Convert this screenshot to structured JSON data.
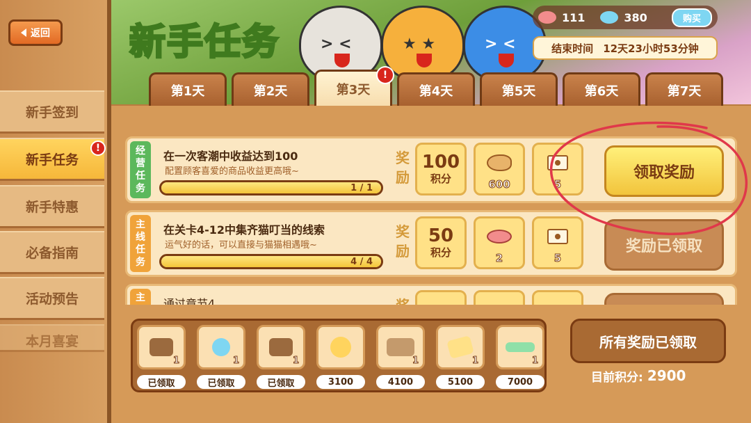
{
  "back": {
    "label": "返回"
  },
  "sidebar": {
    "items": [
      {
        "label": "新手签到"
      },
      {
        "label": "新手任务",
        "badge": "!"
      },
      {
        "label": "新手特惠"
      },
      {
        "label": "必备指南"
      },
      {
        "label": "活动预告"
      },
      {
        "label": "本月喜宴"
      }
    ]
  },
  "header": {
    "title": "新手任务",
    "currency": {
      "fish_pink": "111",
      "fish_blue": "380",
      "buy_label": "购买"
    },
    "end_time": {
      "label": "结束时间",
      "value": "12天23小时53分钟"
    }
  },
  "tabs": [
    {
      "label": "第1天"
    },
    {
      "label": "第2天"
    },
    {
      "label": "第3天",
      "badge": "!"
    },
    {
      "label": "第4天"
    },
    {
      "label": "第5天"
    },
    {
      "label": "第6天"
    },
    {
      "label": "第7天"
    }
  ],
  "tasks": [
    {
      "tag": [
        "经",
        "营",
        "任",
        "务"
      ],
      "title": "在一次客潮中收益达到100",
      "desc": "配置顾客喜爱的商品收益更高哦~",
      "progress_text": "1 / 1",
      "progress": 1.0,
      "reward_label": [
        "奖",
        "励"
      ],
      "points_value": "100",
      "points_unit": "积分",
      "reward2_count": "600",
      "reward3_count": "5",
      "button": "领取奖励"
    },
    {
      "tag": [
        "主",
        "线",
        "任",
        "务"
      ],
      "title": "在关卡4-12中集齐猫叮当的线索",
      "desc": "运气好的话，可以直接与猫猫相遇哦~",
      "progress_text": "4 / 4",
      "progress": 1.0,
      "reward_label": [
        "奖",
        "励"
      ],
      "points_value": "50",
      "points_unit": "积分",
      "reward2_count": "2",
      "reward3_count": "5",
      "button": "奖励已领取"
    },
    {
      "tag": [
        "主"
      ],
      "title": "通过章节4",
      "reward_label": [
        "奖"
      ]
    }
  ],
  "milestones": [
    {
      "qty": "1",
      "label": "已领取"
    },
    {
      "qty": "1",
      "label": "已领取"
    },
    {
      "qty": "1",
      "label": "已领取"
    },
    {
      "qty": "",
      "label": "3100"
    },
    {
      "qty": "1",
      "label": "4100"
    },
    {
      "qty": "1",
      "label": "5100"
    },
    {
      "qty": "1",
      "label": "7000"
    }
  ],
  "summary": {
    "all_claimed": "所有奖励已领取",
    "points_label": "目前积分:",
    "points_value": "2900"
  },
  "colors": {
    "accent": "#f4c53a",
    "brand_wood": "#a96a33",
    "alert": "#d8261c",
    "annotation": "#e0384a"
  }
}
